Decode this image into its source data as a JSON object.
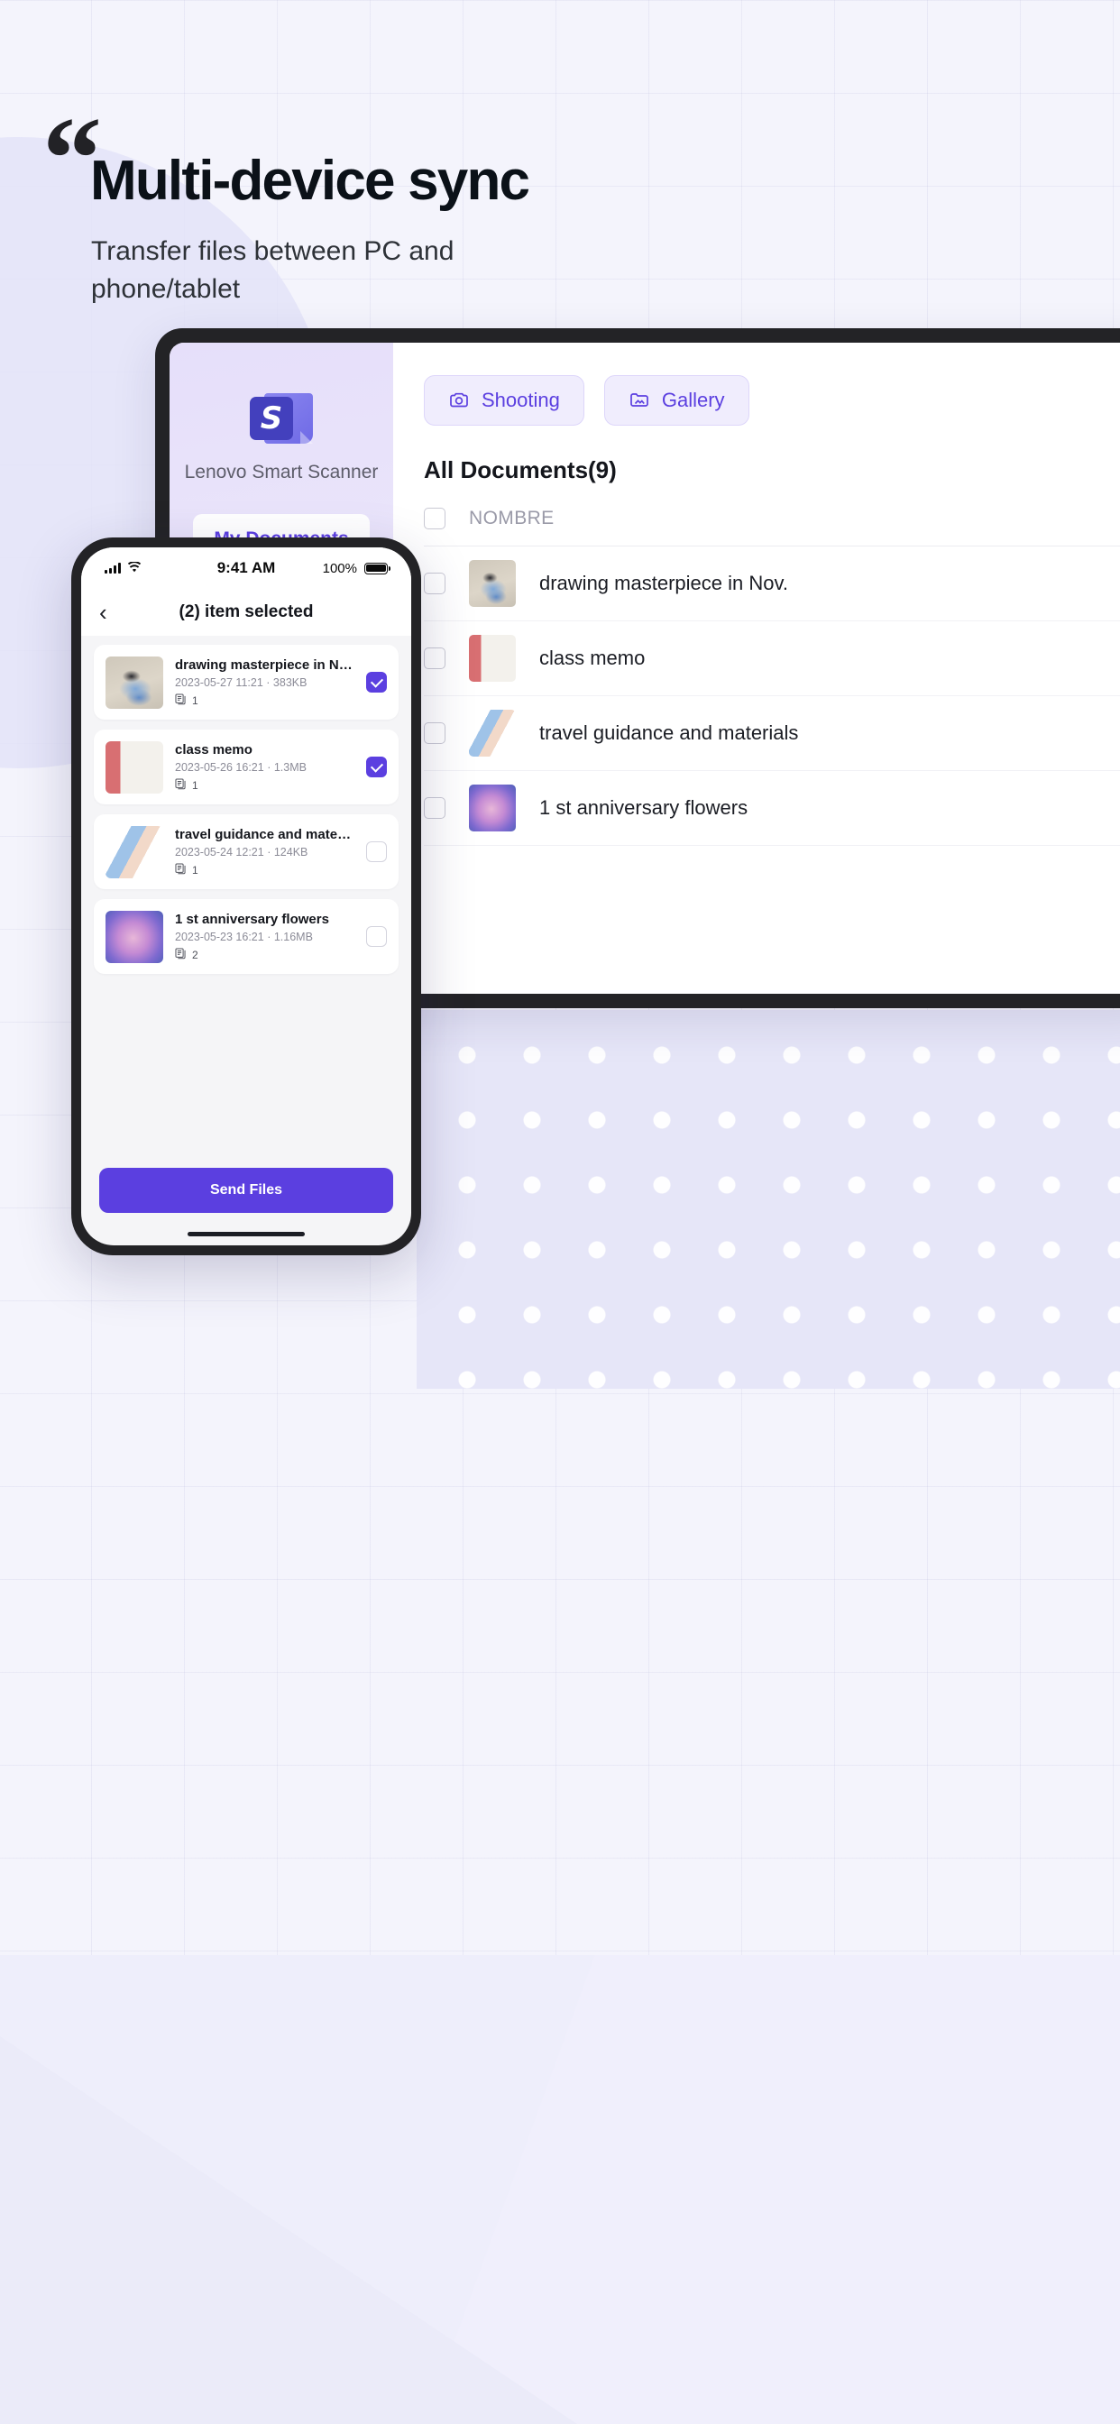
{
  "page": {
    "quote_mark": "“",
    "title": "Multi-device sync",
    "subtitle": "Transfer files between PC and phone/tablet",
    "accent_color": "#5b3fe0",
    "background_color": "#f4f4fc"
  },
  "tablet": {
    "sidebar": {
      "logo_letter": "S",
      "app_name": "Lenovo Smart Scanner",
      "my_documents_label": "My Documents"
    },
    "toolbar": {
      "shooting_label": "Shooting",
      "gallery_label": "Gallery",
      "shooting_icon": "camera-icon",
      "gallery_icon": "folder-image-icon"
    },
    "list": {
      "heading": "All Documents(9)",
      "column_header": "NOMBRE",
      "rows": [
        {
          "name": "drawing masterpiece in Nov.",
          "thumb": "bird"
        },
        {
          "name": "class memo",
          "thumb": "memo"
        },
        {
          "name": "travel guidance and materials",
          "thumb": "travel"
        },
        {
          "name": "1 st anniversary flowers",
          "thumb": "flower"
        }
      ]
    }
  },
  "phone": {
    "status_bar": {
      "time": "9:41 AM",
      "battery_percent": "100%",
      "signal_icon": "cellular-bars-icon",
      "wifi_icon": "wifi-icon",
      "battery_icon": "battery-full-icon"
    },
    "nav": {
      "back_icon": "chevron-left-icon",
      "title": "(2) item selected"
    },
    "documents": [
      {
        "title": "drawing masterpiece in Nov.",
        "date": "2023-05-27 11:21",
        "size": "383KB",
        "pages": "1",
        "selected": true,
        "thumb": "bird"
      },
      {
        "title": "class memo",
        "date": "2023-05-26 16:21",
        "size": "1.3MB",
        "pages": "1",
        "selected": true,
        "thumb": "memo"
      },
      {
        "title": "travel guidance and materials",
        "date": "2023-05-24 12:21",
        "size": "124KB",
        "pages": "1",
        "selected": false,
        "thumb": "travel"
      },
      {
        "title": "1 st anniversary flowers",
        "date": "2023-05-23 16:21",
        "size": "1.16MB",
        "pages": "2",
        "selected": false,
        "thumb": "flower"
      }
    ],
    "separator": "·",
    "pages_icon": "pages-icon",
    "send_button_label": "Send Files"
  }
}
